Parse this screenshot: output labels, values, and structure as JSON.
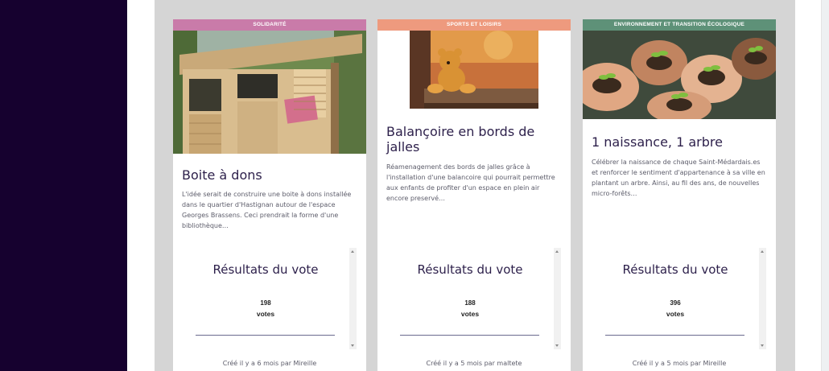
{
  "colors": {
    "sidebar_dark": "#16012f",
    "panel_gray": "#d5d5d5",
    "solidarite": "#c97ba9",
    "sports": "#ee9a7e",
    "environnement": "#5e9178",
    "title_text": "#2c1f4a"
  },
  "cards": [
    {
      "category": "SOLIDARITÉ",
      "image": "donation-box-photo",
      "title": "Boite à dons",
      "description": "L'idée serait de construire une boite à dons installée dans le quartier d'Hastignan autour de l'espace Georges Brassens. Ceci prendrait la forme d'une bibliothèque…",
      "results_title": "Résultats du vote",
      "votes": "198",
      "votes_label": "votes",
      "footer": "Créé il y a 6 mois par Mireille"
    },
    {
      "category": "SPORTS ET LOISIRS",
      "image": "teddy-bear-swing-photo",
      "title": "Balançoire en bords de jalles",
      "description": "Réamenagement des bords de jalles grâce à l'installation d'une balancoire qui pourrait permettre aux enfants de profiter d'un espace en plein air encore preservé…",
      "results_title": "Résultats du vote",
      "votes": "188",
      "votes_label": "votes",
      "footer": "Créé il y a 5 mois par maltete"
    },
    {
      "category": "ENVIRONNEMENT ET TRANSITION ÉCOLOGIQUE",
      "image": "hands-seedlings-photo",
      "title": "1 naissance, 1 arbre",
      "description": "Célébrer la naissance de chaque Saint-Médardais.es et renforcer le sentiment d'appartenance à sa ville en plantant un arbre. Ainsi, au fil des ans, de nouvelles micro-forêts…",
      "results_title": "Résultats du vote",
      "votes": "396",
      "votes_label": "votes",
      "footer": "Créé il y a 5 mois par Mireille"
    }
  ]
}
